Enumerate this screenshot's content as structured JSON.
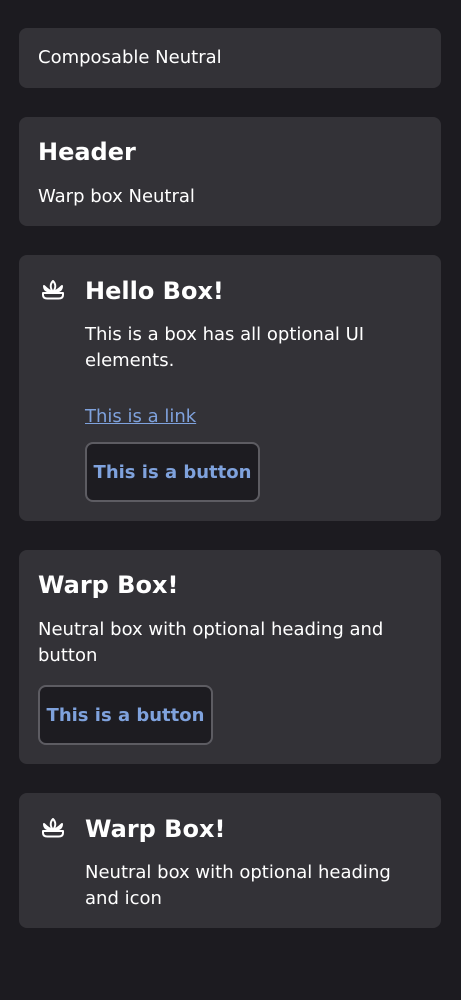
{
  "composable_box": {
    "text": "Composable Neutral"
  },
  "warp_box_header": {
    "heading": "Header",
    "text": "Warp box Neutral"
  },
  "hello_box": {
    "icon": "lotus-icon",
    "heading": "Hello Box!",
    "text": "This is a box has all optional UI elements.",
    "link_label": "This is a link",
    "button_label": "This is a button"
  },
  "warp_box_button": {
    "heading": "Warp Box!",
    "text": "Neutral box with optional heading and button",
    "button_label": "This is a button"
  },
  "warp_box_icon": {
    "icon": "lotus-icon",
    "heading": "Warp Box!",
    "text": "Neutral box with optional heading and icon"
  },
  "colors": {
    "background": "#1c1b20",
    "box": "#333237",
    "link": "#7fa2dd",
    "button_border": "#5d5c62"
  }
}
